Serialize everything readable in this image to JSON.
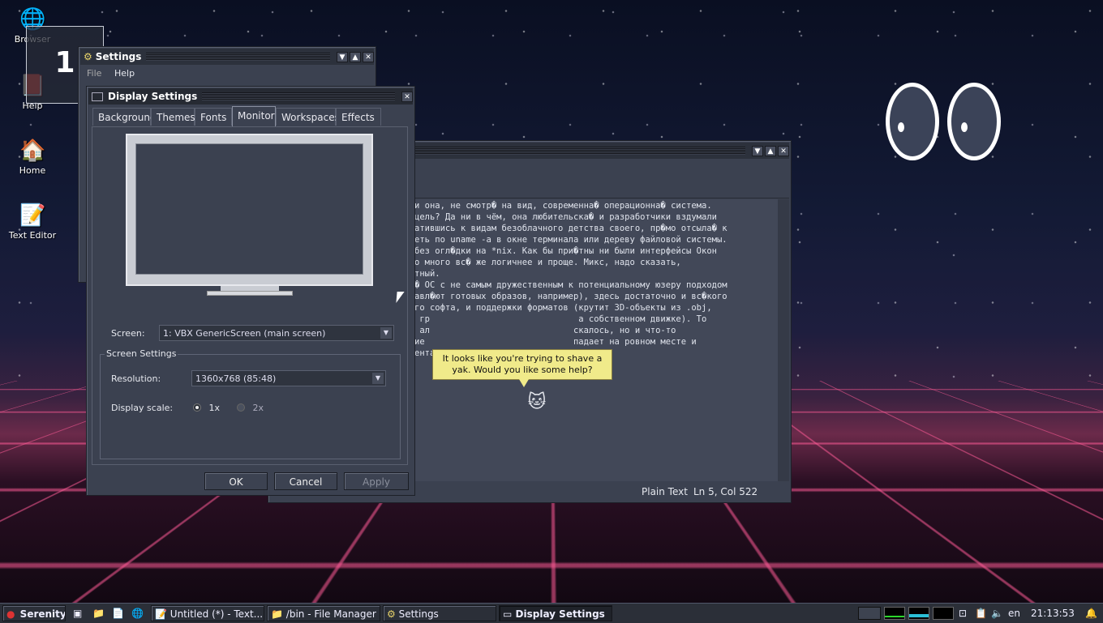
{
  "desktop": {
    "icons": [
      {
        "label": "Browser",
        "glyph": "🌐",
        "name": "browser"
      },
      {
        "label": "Help",
        "glyph": "📕",
        "name": "help"
      },
      {
        "label": "Home",
        "glyph": "🏠",
        "name": "home"
      },
      {
        "label": "Text Editor",
        "glyph": "📝",
        "name": "text-editor"
      }
    ],
    "workspace_number": "1"
  },
  "settings_bg": {
    "title": "Settings",
    "menu": [
      "File",
      "Help"
    ]
  },
  "display_settings": {
    "title": "Display Settings",
    "tabs": [
      "Background",
      "Themes",
      "Fonts",
      "Monitor",
      "Workspaces",
      "Effects"
    ],
    "selected_tab": "Monitor",
    "screen_label": "Screen:",
    "screen_value": "1: VBX GenericScreen (main screen)",
    "group_title": "Screen Settings",
    "resolution_label": "Resolution:",
    "resolution_value": "1360x768 (85:48)",
    "scale_label": "Display scale:",
    "scale_options": [
      "1x",
      "2x"
    ],
    "scale_selected": "1x",
    "ok": "OK",
    "cancel": "Cancel",
    "apply": "Apply"
  },
  "text_editor": {
    "status_mode": "Plain Text",
    "status_pos": "Ln 5, Col 522",
    "lines": [
      "и она, не смотр� на вид, современна� операционна� система.",
      "цель? Да ни в чём, она любительска� и разработчики вздумали",
      "атившись к видам безоблачного детства своего, пр�мо отсыла� к",
      "",
      "",
      "еть по uname -a в окне терминала или дереву файловой системы.",
      "без огл�дки на *nix. Как бы при�тны ни были интерфейсы Окон",
      "о много вс� же логичнее и проще. Микс, надо сказать,",
      "тный.",
      "",
      "� ОС с не самым дружественным к потенциальному юзеру подходом",
      "авл�ют готовых образов, например), здесь достаточно и вс�кого",
      "го софта, и поддержки форматов (крутит 3D-объекты из .obj,",
      " гр                             а собственном движке). То",
      " ал                            скалось, но и что-то",
      "ие                             падает на ровном месте и",
      "ентально."
    ]
  },
  "assistant": {
    "tip": "It looks like you're trying to shave a yak. Would you like some help?"
  },
  "taskbar": {
    "start": "Serenity",
    "buttons": [
      "Untitled (*) - Text...",
      "/bin - File Manager",
      "Settings",
      "Display Settings"
    ],
    "active": "Display Settings",
    "keymap": "en",
    "clock": "21:13:53"
  },
  "colors": {
    "accent": "#f0ea8a",
    "desktop_grid": "#ff5a96"
  }
}
